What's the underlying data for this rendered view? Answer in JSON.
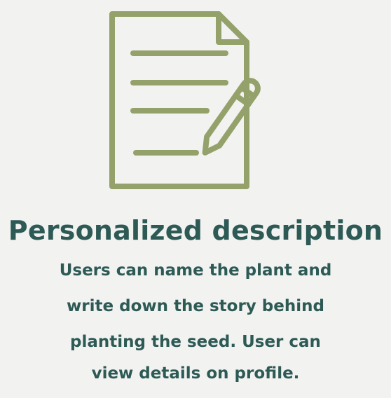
{
  "colors": {
    "background": "#f2f2f1",
    "icon": "#95a16a",
    "text": "#2d5a55"
  },
  "icon": {
    "name": "document-with-pencil-icon"
  },
  "feature": {
    "title": "Personalized description",
    "description_lines": [
      "Users can name the plant and",
      "write down the story behind",
      "planting the seed. User can",
      "view details on profile."
    ]
  }
}
